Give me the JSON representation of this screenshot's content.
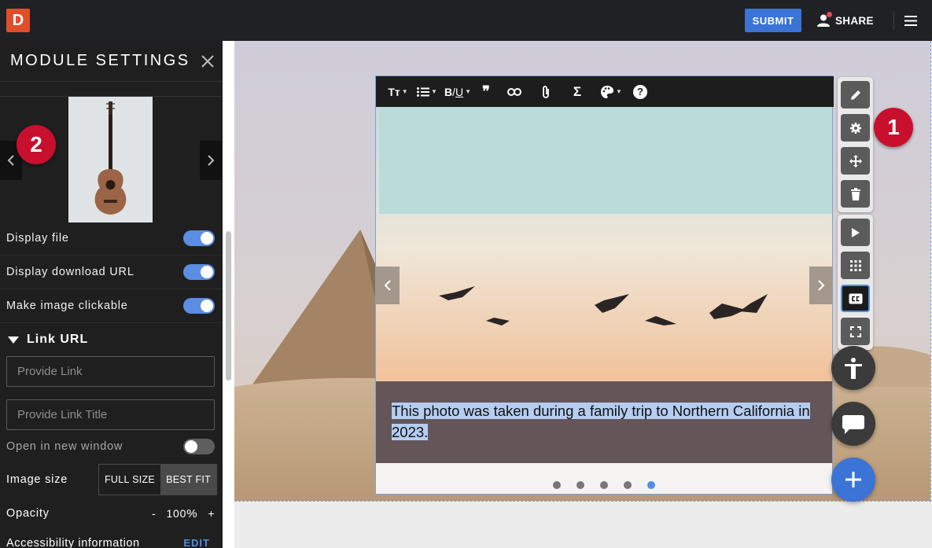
{
  "topbar": {
    "logo": "D",
    "submit_label": "SUBMIT",
    "share_label": "SHARE"
  },
  "panel": {
    "title": "MODULE SETTINGS",
    "marker_label": "2",
    "settings": [
      {
        "label": "Display file",
        "on": true
      },
      {
        "label": "Display download URL",
        "on": true
      },
      {
        "label": "Make image clickable",
        "on": true
      }
    ],
    "link_section": "Link URL",
    "link_placeholder": "Provide Link",
    "link_title_placeholder": "Provide Link Title",
    "new_window_label": "Open in new window",
    "new_window_on": false,
    "image_size_label": "Image size",
    "size_options": [
      "FULL SIZE",
      "BEST FIT"
    ],
    "size_selected": "BEST FIT",
    "opacity_label": "Opacity",
    "opacity_minus": "-",
    "opacity_value": "100",
    "opacity_unit": "%",
    "opacity_plus": "+",
    "accessibility_label": "Accessibility information",
    "edit_label": "EDIT"
  },
  "module": {
    "caption": "This photo was taken during a family trip to Northern California in 2023.",
    "slide_count": 5,
    "active_slide": 5,
    "marker_label": "1"
  },
  "icons": {
    "text_size": "Tт",
    "bold_underline_b": "B",
    "bold_underline_sep": "/",
    "bold_underline_u": "U",
    "quote": "❞",
    "sigma": "Σ",
    "help": "?"
  },
  "colors": {
    "accent": "#3b73d6",
    "marker": "#c8102e",
    "caption_highlight": "#b4cdf1"
  }
}
